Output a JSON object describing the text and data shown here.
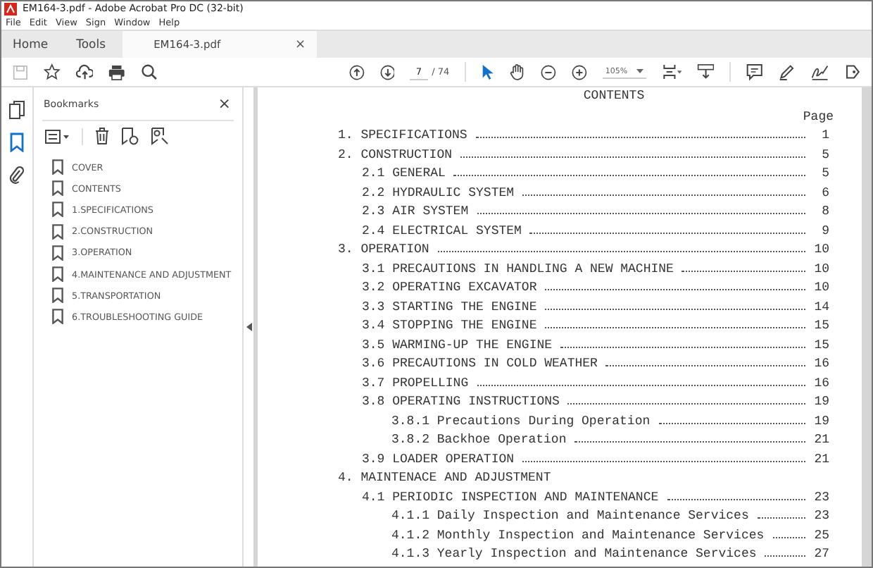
{
  "window": {
    "title": "EM164-3.pdf - Adobe Acrobat Pro DC (32-bit)"
  },
  "menu": [
    "File",
    "Edit",
    "View",
    "Sign",
    "Window",
    "Help"
  ],
  "tabs": [
    {
      "label": "Home",
      "selected": false,
      "kind": "nav"
    },
    {
      "label": "Tools",
      "selected": false,
      "kind": "nav"
    },
    {
      "label": "EM164-3.pdf",
      "selected": true,
      "kind": "doc",
      "close": "×"
    }
  ],
  "toolbar": {
    "page": "7",
    "page_total": "/ 74",
    "zoom": "105%"
  },
  "bookmarks": {
    "title": "Bookmarks",
    "close": "×",
    "items": [
      {
        "label": "COVER"
      },
      {
        "label": "CONTENTS"
      },
      {
        "label": "1.SPECIFICATIONS"
      },
      {
        "label": "2.CONSTRUCTION"
      },
      {
        "label": "3.OPERATION"
      },
      {
        "label": "4.MAINTENANCE AND ADJUSTMENT"
      },
      {
        "label": "5.TRANSPORTATION"
      },
      {
        "label": "6.TROUBLESHOOTING GUIDE"
      }
    ]
  },
  "document": {
    "title": "CONTENTS",
    "page_heading": "Page",
    "entries": [
      {
        "title": "1. SPECIFICATIONS",
        "page": "1"
      },
      {
        "title": "2. CONSTRUCTION",
        "page": "5",
        "children": [
          {
            "title": "2.1 GENERAL",
            "page": "5"
          },
          {
            "title": "2.2 HYDRAULIC SYSTEM",
            "page": "6"
          },
          {
            "title": "2.3 AIR SYSTEM",
            "page": "8"
          },
          {
            "title": "2.4 ELECTRICAL SYSTEM",
            "page": "9"
          }
        ]
      },
      {
        "title": "3. OPERATION",
        "page": "10",
        "children": [
          {
            "title": "3.1 PRECAUTIONS IN HANDLING A NEW MACHINE",
            "page": "10"
          },
          {
            "title": "3.2 OPERATING EXCAVATOR",
            "page": "10"
          },
          {
            "title": "3.3 STARTING THE ENGINE",
            "page": "14"
          },
          {
            "title": "3.4 STOPPING THE ENGINE",
            "page": "15"
          },
          {
            "title": "3.5 WARMING-UP THE ENGINE",
            "page": "15"
          },
          {
            "title": "3.6 PRECAUTIONS IN COLD WEATHER",
            "page": "16"
          },
          {
            "title": "3.7 PROPELLING",
            "page": "16"
          },
          {
            "title": "3.8 OPERATING INSTRUCTIONS",
            "page": "19",
            "children": [
              {
                "title": "3.8.1 Precautions During Operation",
                "page": "19"
              },
              {
                "title": "3.8.2 Backhoe Operation",
                "page": "21"
              }
            ]
          },
          {
            "title": "3.9 LOADER OPERATION",
            "page": "21"
          }
        ]
      },
      {
        "title": "4. MAINTENACE AND ADJUSTMENT",
        "children": [
          {
            "title": "4.1 PERIODIC INSPECTION AND MAINTENANCE",
            "page": "23",
            "children": [
              {
                "title": "4.1.1 Daily Inspection and Maintenance Services",
                "page": "23"
              },
              {
                "title": "4.1.2 Monthly Inspection and Maintenance Services",
                "page": "25"
              },
              {
                "title": "4.1.3 Yearly Inspection and Maintenance Services",
                "page": "27"
              }
            ]
          }
        ]
      }
    ]
  }
}
